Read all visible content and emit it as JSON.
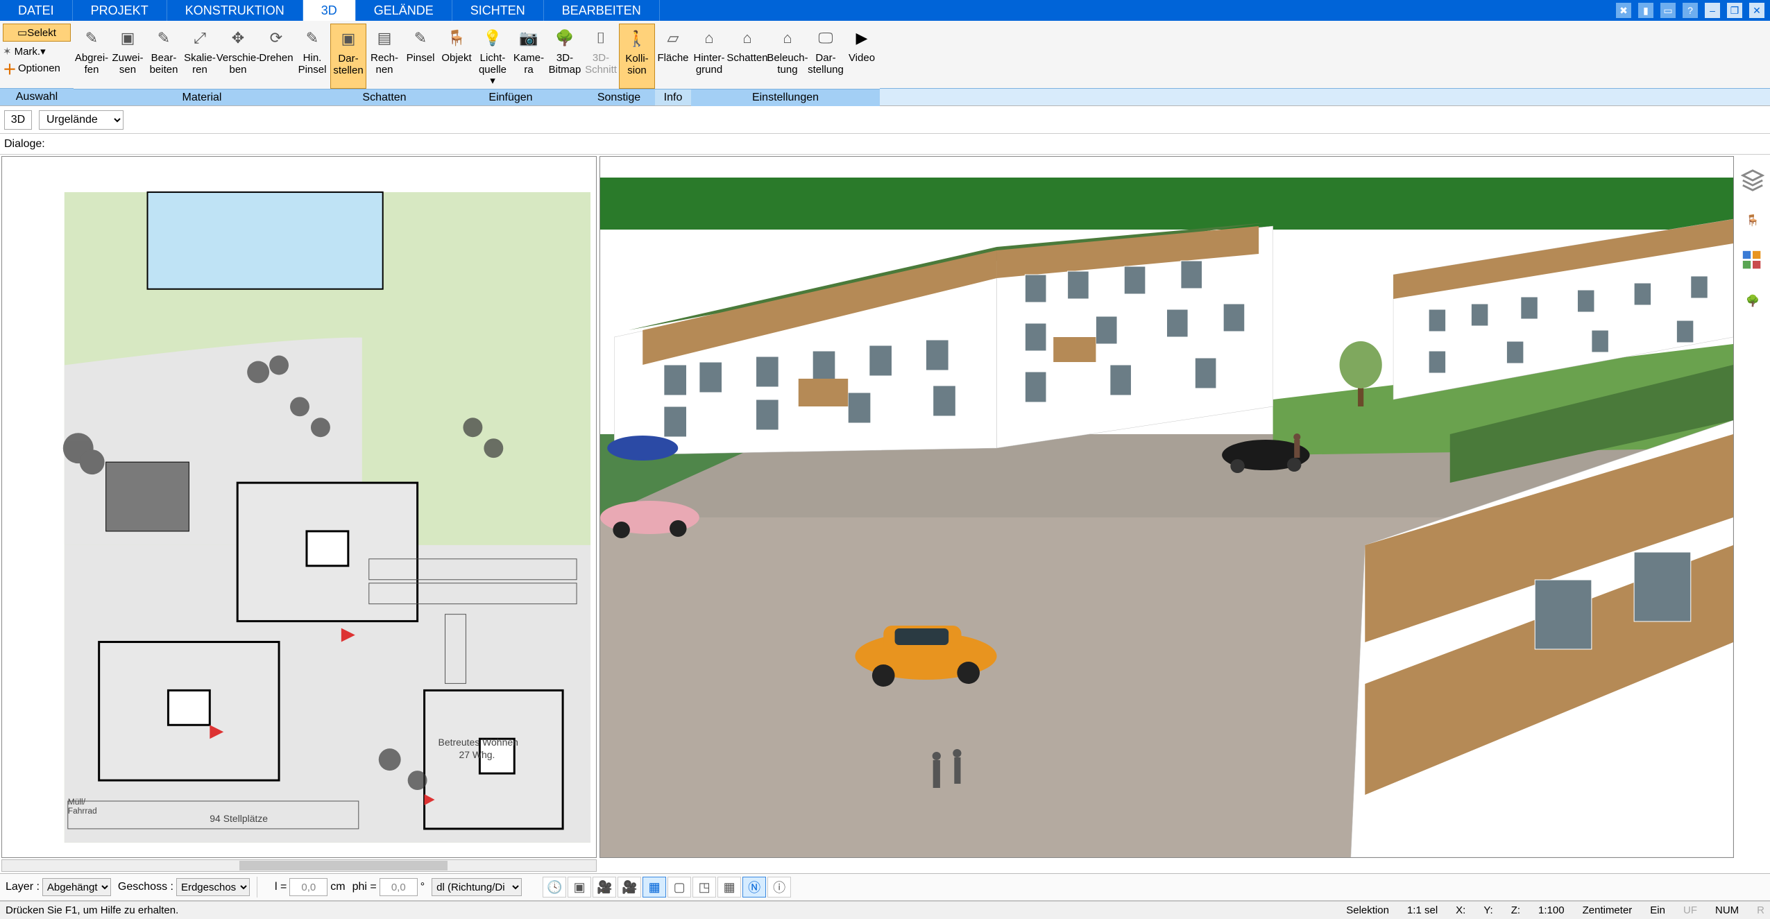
{
  "tabs": [
    "DATEI",
    "PROJEKT",
    "KONSTRUKTION",
    "3D",
    "GELÄNDE",
    "SICHTEN",
    "BEARBEITEN"
  ],
  "active_tab": "3D",
  "selection": {
    "selekt": "Selekt",
    "mark": "Mark.",
    "optionen": "Optionen"
  },
  "groups": {
    "auswahl": "Auswahl",
    "material": "Material",
    "schatten": "Schatten",
    "einfuegen": "Einfügen",
    "sonstige": "Sonstige",
    "info": "Info",
    "einstellungen": "Einstellungen"
  },
  "ribbon": {
    "material": [
      {
        "l1": "Abgrei-",
        "l2": "fen"
      },
      {
        "l1": "Zuwei-",
        "l2": "sen"
      },
      {
        "l1": "Bear-",
        "l2": "beiten"
      },
      {
        "l1": "Skalie-",
        "l2": "ren"
      },
      {
        "l1": "Verschie-",
        "l2": "ben"
      },
      {
        "l1": "Drehen",
        "l2": ""
      },
      {
        "l1": "Hin.",
        "l2": "Pinsel"
      }
    ],
    "schatten": [
      {
        "l1": "Dar-",
        "l2": "stellen",
        "active": true
      },
      {
        "l1": "Rech-",
        "l2": "nen"
      },
      {
        "l1": "Pinsel",
        "l2": ""
      }
    ],
    "einfuegen": [
      {
        "l1": "Objekt",
        "l2": ""
      },
      {
        "l1": "Licht-",
        "l2": "quelle",
        "drop": true
      },
      {
        "l1": "Kame-",
        "l2": "ra"
      },
      {
        "l1": "3D-",
        "l2": "Bitmap"
      }
    ],
    "sonstige": [
      {
        "l1": "3D-",
        "l2": "Schnitt",
        "disabled": true
      },
      {
        "l1": "Kolli-",
        "l2": "sion",
        "active": true
      }
    ],
    "info": [
      {
        "l1": "Fläche",
        "l2": ""
      }
    ],
    "einstellungen": [
      {
        "l1": "Hinter-",
        "l2": "grund"
      },
      {
        "l1": "Schatten",
        "l2": ""
      },
      {
        "l1": "Beleuch-",
        "l2": "tung"
      },
      {
        "l1": "Dar-",
        "l2": "stellung"
      },
      {
        "l1": "Video",
        "l2": ""
      }
    ]
  },
  "context": {
    "mode": "3D",
    "view": "Urgelände"
  },
  "dialoge_label": "Dialoge:",
  "plan_annotations": {
    "stellplaetze": "94 Stellplätze",
    "wohnen1": "Betreutes Wohnen",
    "wohnen2": "27 Whg.",
    "muell": "Müll/\nFahrrad"
  },
  "lowbar": {
    "layer_label": "Layer :",
    "layer_value": "Abgehängt",
    "geschoss_label": "Geschoss :",
    "geschoss_value": "Erdgeschos",
    "l_label": "l =",
    "l_value": "0,0",
    "l_unit": "cm",
    "phi_label": "phi =",
    "phi_value": "0,0",
    "phi_unit": "°",
    "dl_value": "dl (Richtung/Di"
  },
  "status": {
    "hint": "Drücken Sie F1, um Hilfe zu erhalten.",
    "selektion": "Selektion",
    "ratio": "1:1 sel",
    "x": "X:",
    "y": "Y:",
    "z": "Z:",
    "scale": "1:100",
    "unit": "Zentimeter",
    "ein": "Ein",
    "uf": "UF",
    "num": "NUM",
    "r": "R"
  }
}
